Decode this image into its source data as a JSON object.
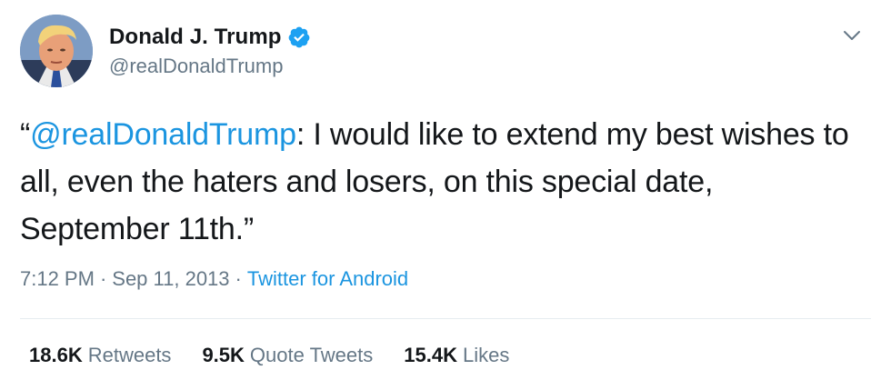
{
  "author": {
    "display_name": "Donald J. Trump",
    "handle": "@realDonaldTrump",
    "verified": true
  },
  "tweet": {
    "open_quote": "“",
    "mention": "@realDonaldTrump",
    "text_after_mention": ": I would like to extend my best wishes to all, even the haters and losers, on this special date, September 11th.”"
  },
  "meta": {
    "time": "7:12 PM",
    "separator": "·",
    "date": "Sep 11, 2013",
    "source": "Twitter for Android"
  },
  "stats": {
    "retweets_count": "18.6K",
    "retweets_label": "Retweets",
    "quote_tweets_count": "9.5K",
    "quote_tweets_label": "Quote Tweets",
    "likes_count": "15.4K",
    "likes_label": "Likes"
  },
  "icons": {
    "verified": "verified-badge-icon",
    "more": "chevron-down-icon"
  },
  "colors": {
    "link": "#1b95e0",
    "secondary_text": "#657786",
    "primary_text": "#14171a",
    "verified": "#1da1f2",
    "divider": "#e6ecf0"
  }
}
